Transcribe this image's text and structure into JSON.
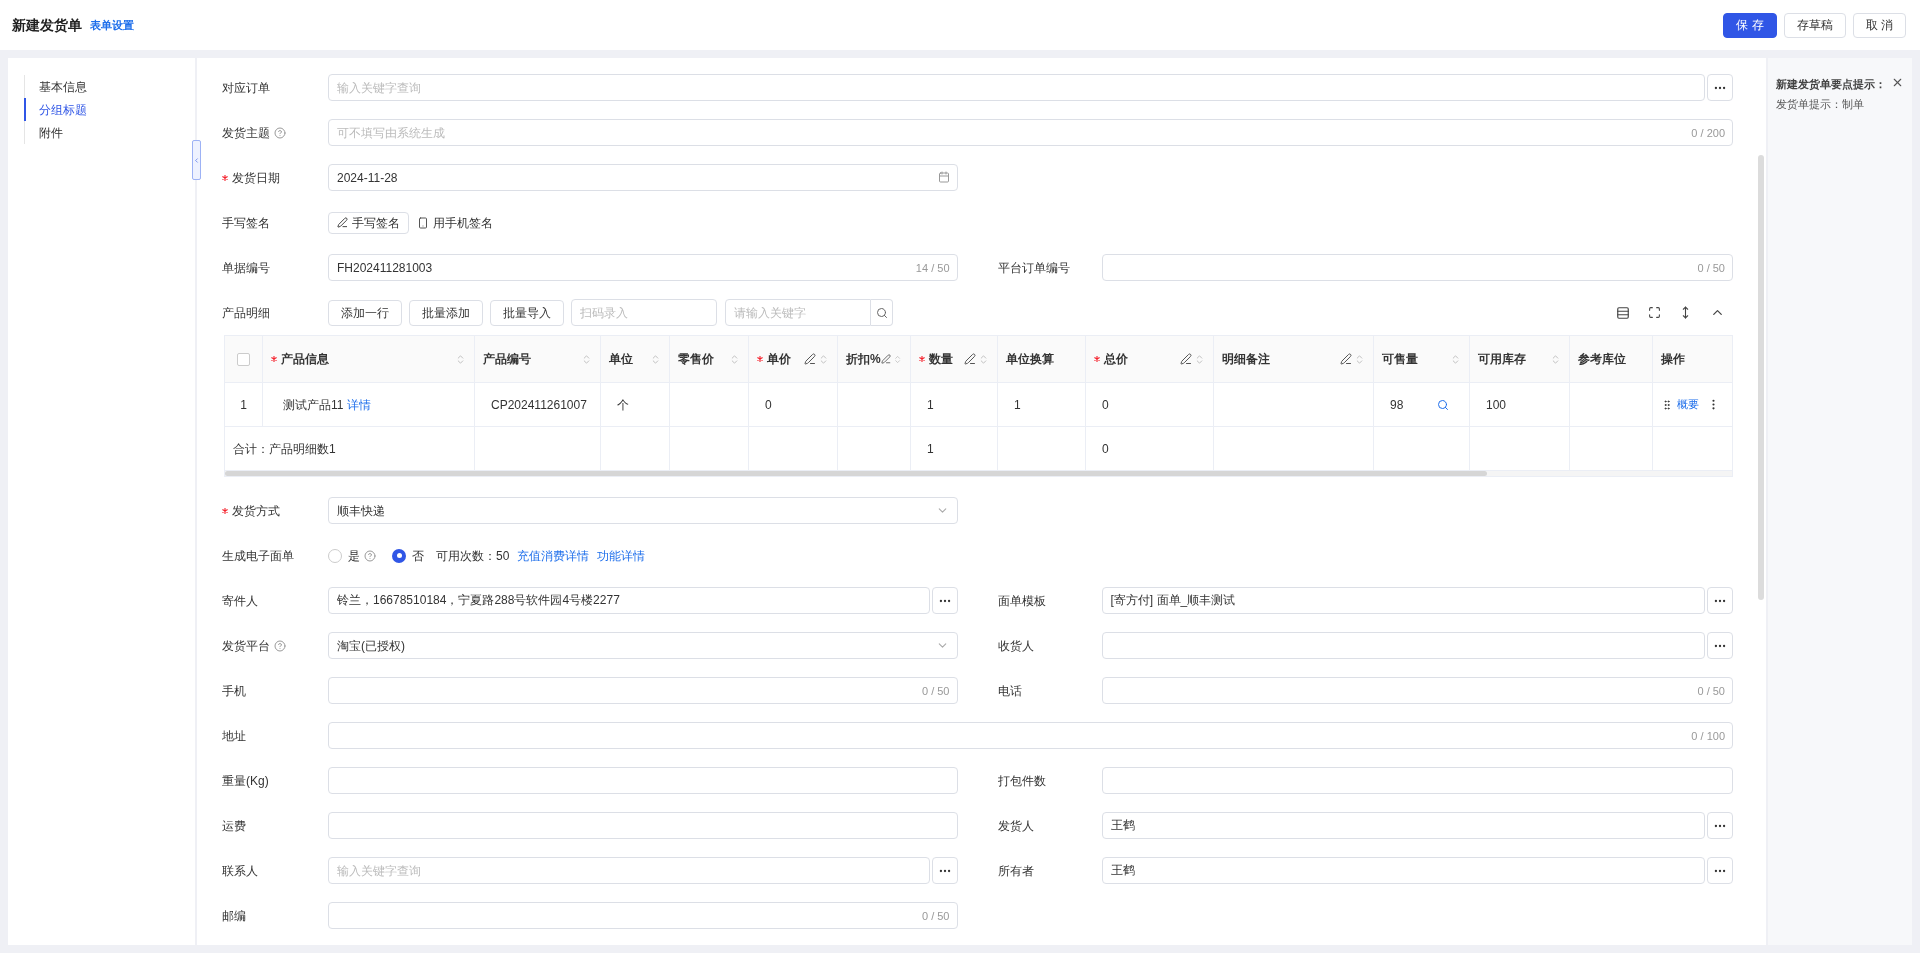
{
  "header": {
    "title": "新建发货单",
    "settings_link": "表单设置",
    "buttons": [
      {
        "label": "保 存",
        "kind": "primary"
      },
      {
        "label": "存草稿",
        "kind": "default"
      },
      {
        "label": "取 消",
        "kind": "default"
      }
    ]
  },
  "nav": {
    "items": [
      {
        "label": "基本信息",
        "selected": false
      },
      {
        "label": "分组标题",
        "selected": true
      },
      {
        "label": "附件",
        "selected": false
      }
    ]
  },
  "rows": [
    {
      "kind": "fields",
      "fields": [
        {
          "kind": "lookup",
          "label": "对应订单",
          "placeholder": "输入关键字查询",
          "wide": true
        }
      ]
    },
    {
      "kind": "fields",
      "fields": [
        {
          "kind": "text",
          "label": "发货主题",
          "help": true,
          "placeholder": "可不填写由系统生成",
          "counter": "0 / 200",
          "wide": true
        }
      ]
    },
    {
      "kind": "fields",
      "fields": [
        {
          "kind": "date",
          "label": "发货日期",
          "required": true,
          "value": "2024-11-28"
        }
      ]
    },
    {
      "kind": "fields",
      "fields": [
        {
          "kind": "signature",
          "label": "手写签名",
          "button": "手写签名",
          "phone_link": "用手机签名"
        }
      ]
    },
    {
      "kind": "fields",
      "fields": [
        {
          "kind": "text",
          "label": "单据编号",
          "value": "FH202411281003",
          "counter": "14 / 50"
        },
        {
          "kind": "text",
          "label": "平台订单编号",
          "counter": "0 / 50"
        }
      ]
    },
    {
      "kind": "products",
      "label": "产品明细",
      "buttons": [
        "添加一行",
        "批量添加",
        "批量导入"
      ],
      "scan_placeholder": "扫码录入",
      "search_placeholder": "请输入关键字",
      "table": {
        "columns": [
          {
            "kind": "checkbox",
            "checked": false
          },
          {
            "kind": "data",
            "label": "产品信息",
            "required": true,
            "sortable": true
          },
          {
            "kind": "data",
            "label": "产品编号",
            "sortable": true
          },
          {
            "kind": "data",
            "label": "单位",
            "sortable": true
          },
          {
            "kind": "data",
            "label": "零售价",
            "sortable": true
          },
          {
            "kind": "data",
            "label": "单价",
            "required": true,
            "editable": true,
            "sortable": true
          },
          {
            "kind": "data",
            "label": "折扣%",
            "editable": true,
            "sortable": true
          },
          {
            "kind": "data",
            "label": "数量",
            "required": true,
            "editable": true,
            "sortable": true
          },
          {
            "kind": "data",
            "label": "单位换算"
          },
          {
            "kind": "data",
            "label": "总价",
            "required": true,
            "editable": true,
            "sortable": true
          },
          {
            "kind": "data",
            "label": "明细备注",
            "editable": true,
            "sortable": true
          },
          {
            "kind": "data",
            "label": "可售量",
            "sortable": true
          },
          {
            "kind": "data",
            "label": "可用库存",
            "sortable": true
          },
          {
            "kind": "data",
            "label": "参考库位"
          },
          {
            "kind": "data",
            "label": "操作"
          }
        ],
        "rows": [
          {
            "cells": [
              "1",
              "测试产品11",
              "CP202411261007",
              "个",
              "",
              "0",
              "",
              "1",
              "1",
              "0",
              "",
              "98",
              "100",
              "",
              ""
            ],
            "detail_link": "详情",
            "action_link": "概要"
          }
        ],
        "totals": {
          "cells": [
            "合计：产品明细数1",
            "",
            "",
            "",
            "",
            "",
            "",
            "1",
            "",
            "0",
            "",
            "",
            "",
            "",
            ""
          ]
        }
      }
    },
    {
      "kind": "fields",
      "fields": [
        {
          "kind": "select",
          "label": "发货方式",
          "required": true,
          "value": "顺丰快递"
        }
      ]
    },
    {
      "kind": "fields",
      "fields": [
        {
          "kind": "radio",
          "label": "生成电子面单",
          "options": [
            {
              "label": "是",
              "selected": false,
              "help": true
            },
            {
              "label": "否",
              "selected": true
            }
          ],
          "quota": "可用次数：50",
          "links": [
            "充值消费详情",
            "功能详情"
          ]
        }
      ]
    },
    {
      "kind": "fields",
      "fields": [
        {
          "kind": "lookup",
          "label": "寄件人",
          "value": "铃兰，16678510184，宁夏路288号软件园4号楼2277"
        },
        {
          "kind": "lookup",
          "label": "面单模板",
          "value": "[寄方付] 面单_顺丰测试"
        }
      ]
    },
    {
      "kind": "fields",
      "fields": [
        {
          "kind": "select",
          "label": "发货平台",
          "help": true,
          "value": "淘宝(已授权)"
        },
        {
          "kind": "lookup",
          "label": "收货人"
        }
      ]
    },
    {
      "kind": "fields",
      "fields": [
        {
          "kind": "text",
          "label": "手机",
          "counter": "0 / 50"
        },
        {
          "kind": "text",
          "label": "电话",
          "counter": "0 / 50"
        }
      ]
    },
    {
      "kind": "fields",
      "fields": [
        {
          "kind": "text",
          "label": "地址",
          "counter": "0 / 100",
          "wide": true
        }
      ]
    },
    {
      "kind": "fields",
      "fields": [
        {
          "kind": "text",
          "label": "重量(Kg)"
        },
        {
          "kind": "text",
          "label": "打包件数"
        }
      ]
    },
    {
      "kind": "fields",
      "fields": [
        {
          "kind": "text",
          "label": "运费"
        },
        {
          "kind": "lookup",
          "label": "发货人",
          "value": "王鹤"
        }
      ]
    },
    {
      "kind": "fields",
      "fields": [
        {
          "kind": "lookup",
          "label": "联系人",
          "placeholder": "输入关键字查询"
        },
        {
          "kind": "lookup",
          "label": "所有者",
          "value": "王鹤"
        }
      ]
    },
    {
      "kind": "fields",
      "fields": [
        {
          "kind": "text",
          "label": "邮编",
          "counter": "0 / 50"
        }
      ]
    }
  ],
  "tips": {
    "title": "新建发货单要点提示：",
    "text": "发货单提示：制单"
  }
}
